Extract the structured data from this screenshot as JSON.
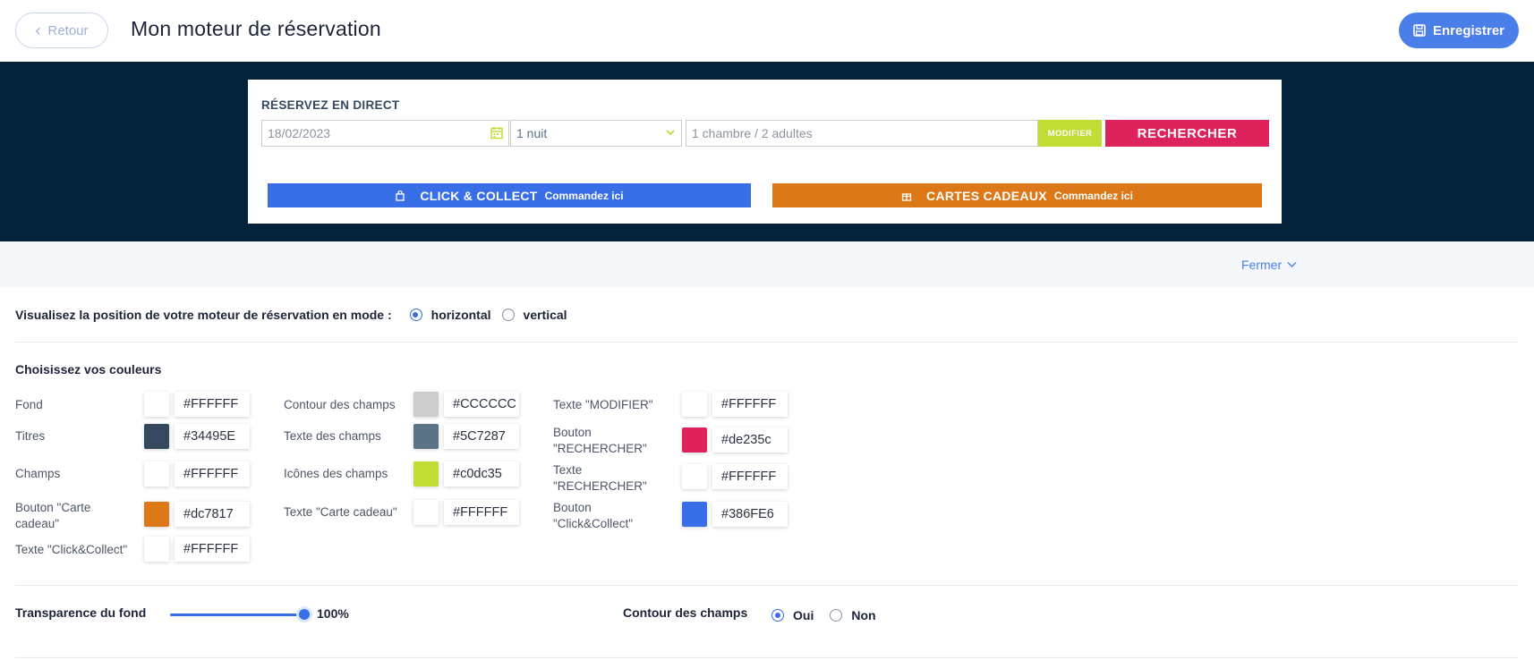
{
  "header": {
    "back_label": "Retour",
    "title": "Mon moteur de réservation",
    "save_label": "Enregistrer"
  },
  "widget": {
    "title": "RÉSERVEZ EN DIRECT",
    "date_value": "18/02/2023",
    "nights_value": "1 nuit",
    "rooms_value": "1 chambre / 2 adultes",
    "modify_label": "MODIFIER",
    "search_label": "RECHERCHER",
    "click_collect_label": "CLICK & COLLECT",
    "click_collect_sub": "Commandez ici",
    "gift_card_label": "CARTES CADEAUX",
    "gift_card_sub": "Commandez ici"
  },
  "close_label": "Fermer",
  "mode": {
    "label": "Visualisez la position de votre moteur de réservation en mode :",
    "options": [
      "horizontal",
      "vertical"
    ],
    "selected": "horizontal"
  },
  "colors": {
    "title": "Choisissez vos couleurs",
    "col1": [
      {
        "label": "Fond",
        "hex": "#FFFFFF"
      },
      {
        "label": "Titres",
        "hex": "#34495E"
      },
      {
        "label": "Champs",
        "hex": "#FFFFFF"
      },
      {
        "label": "Bouton \"Carte cadeau\"",
        "hex": "#dc7817"
      },
      {
        "label": "Texte \"Click&Collect\"",
        "hex": "#FFFFFF"
      }
    ],
    "col2": [
      {
        "label": "Contour des champs",
        "hex": "#CCCCCC"
      },
      {
        "label": "Texte des champs",
        "hex": "#5C7287"
      },
      {
        "label": "Icônes des champs",
        "hex": "#c0dc35"
      },
      {
        "label": "Texte \"Carte cadeau\"",
        "hex": "#FFFFFF"
      }
    ],
    "col3": [
      {
        "label": "Texte \"MODIFIER\"",
        "hex": "#FFFFFF"
      },
      {
        "label": "Bouton \"RECHERCHER\"",
        "hex": "#de235c"
      },
      {
        "label": "Texte \"RECHERCHER\"",
        "hex": "#FFFFFF"
      },
      {
        "label": "Bouton \"Click&Collect\"",
        "hex": "#386FE6"
      }
    ]
  },
  "transparency": {
    "label": "Transparence du fond",
    "value": "100%",
    "fraction": 1.0
  },
  "outline": {
    "label": "Contour des champs",
    "options": [
      "Oui",
      "Non"
    ],
    "selected": "Oui"
  },
  "theme": {
    "accent": "#386fe6",
    "dark_band": "#04223a",
    "save_button": "#4a7ee8"
  }
}
